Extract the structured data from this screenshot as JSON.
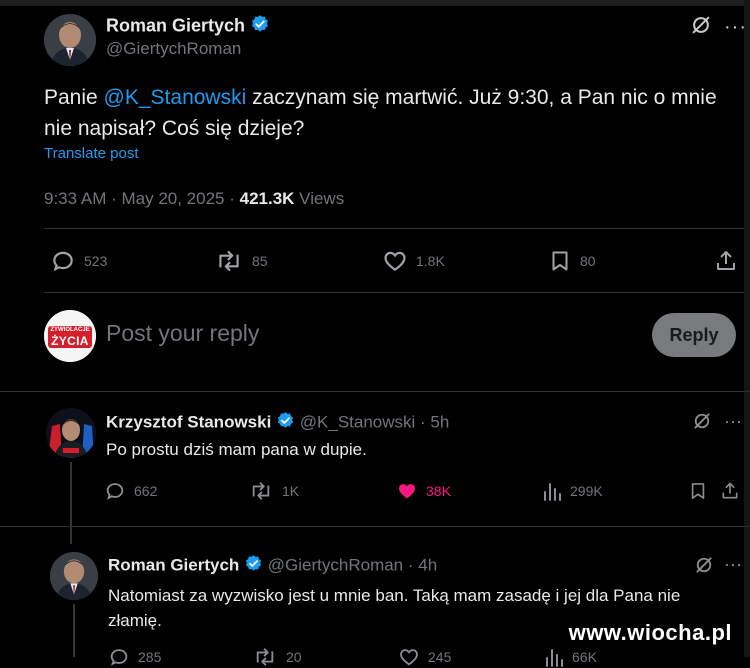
{
  "main_post": {
    "author_name": "Roman Giertych",
    "author_handle": "@GiertychRoman",
    "text_prefix": "Panie ",
    "mention": "@K_Stanowski",
    "text_line1_rest": " zaczynam się martwić. Już 9:30, a Pan nic o mnie",
    "text_line2": "nie napisał? Coś się dzieje?",
    "translate_label": "Translate post",
    "timestamp": "9:33 AM · May 20, 2025 · ",
    "views_count": "421.3K",
    "views_label": " Views",
    "replies": "523",
    "reposts": "85",
    "likes": "1.8K",
    "bookmarks": "80"
  },
  "reply_box": {
    "placeholder": "Post your reply",
    "button_label": "Reply",
    "avatar_text_top": "ZYWIOLACJE",
    "avatar_text_main": "ŻYCIA"
  },
  "reply1": {
    "author_name": "Krzysztof Stanowski",
    "author_handle": "@K_Stanowski · 5h",
    "text": "Po prostu dziś mam pana w dupie.",
    "replies": "662",
    "reposts": "1K",
    "likes": "38K",
    "views": "299K"
  },
  "reply2": {
    "author_name": "Roman Giertych",
    "author_handle": "@GiertychRoman · 4h",
    "text_line1": "Natomiast za wyzwisko jest u mnie ban. Taką mam zasadę i jej dla Pana nie",
    "text_line2": "złamię.",
    "replies": "285",
    "reposts": "20",
    "likes": "245",
    "views": "66K"
  },
  "watermark": "www.wiocha.pl",
  "colors": {
    "background": "#000000",
    "text": "#e7e9ea",
    "muted": "#71767b",
    "link": "#1d9bf0",
    "like_active": "#f91880",
    "verified": "#1d9bf0"
  }
}
